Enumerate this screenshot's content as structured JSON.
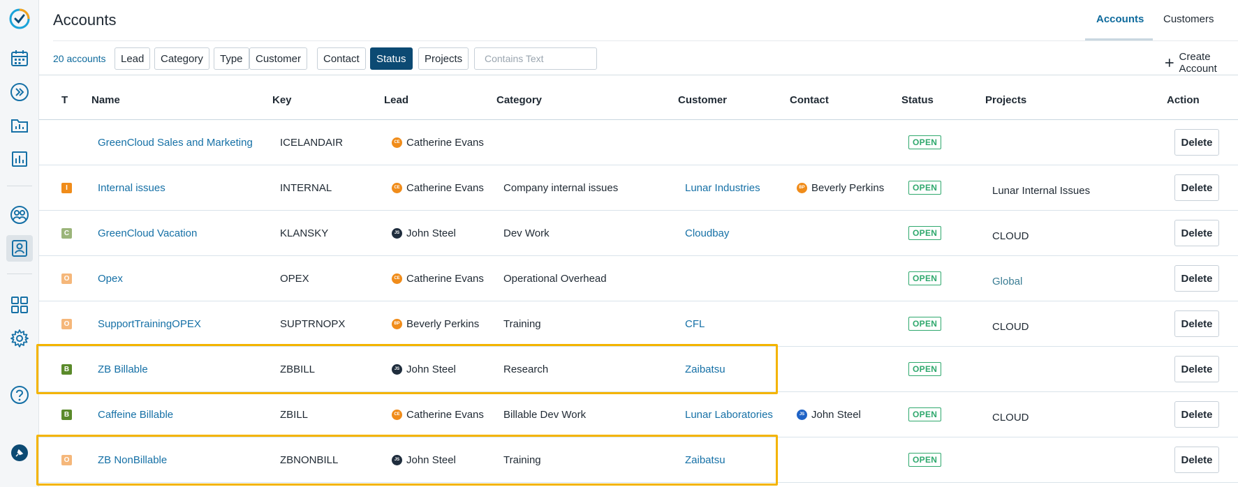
{
  "header": {
    "title": "Accounts",
    "tabs": [
      {
        "label": "Accounts",
        "active": true
      },
      {
        "label": "Customers",
        "active": false
      }
    ]
  },
  "filters": {
    "count_label": "20 accounts",
    "chips": [
      {
        "label": "Lead",
        "active": false
      },
      {
        "label": "Category",
        "active": false
      },
      {
        "label": "Type",
        "active": false
      },
      {
        "label": "Customer",
        "active": false
      },
      {
        "label": "Contact",
        "active": false
      },
      {
        "label": "Status",
        "active": true
      },
      {
        "label": "Projects",
        "active": false
      }
    ],
    "search_placeholder": "Contains Text",
    "create_label": "Create Account"
  },
  "table": {
    "columns": [
      "T",
      "Name",
      "Key",
      "Lead",
      "Category",
      "Customer",
      "Contact",
      "Status",
      "Projects",
      "Action"
    ],
    "rows": [
      {
        "type": "",
        "type_color": "",
        "name": "GreenCloud Sales and Marketing",
        "key": "ICELANDAIR",
        "lead": "Catherine Evans",
        "lead_initials": "CE",
        "lead_color": "#f08c1a",
        "category": "",
        "customer": "",
        "contact": "",
        "contact_initials": "",
        "contact_color": "",
        "status": "OPEN",
        "projects": "",
        "action": "Delete"
      },
      {
        "type": "I",
        "type_color": "#f08c1a",
        "name": "Internal issues",
        "key": "INTERNAL",
        "lead": "Catherine Evans",
        "lead_initials": "CE",
        "lead_color": "#f08c1a",
        "category": "Company internal issues",
        "customer": "Lunar Industries",
        "contact": "Beverly Perkins",
        "contact_initials": "BP",
        "contact_color": "#f08c1a",
        "status": "OPEN",
        "projects": "Lunar Internal Issues",
        "action": "Delete"
      },
      {
        "type": "C",
        "type_color": "#9bb57a",
        "name": "GreenCloud Vacation",
        "key": "KLANSKY",
        "lead": "John Steel",
        "lead_initials": "JS",
        "lead_color": "#1f2d3d",
        "category": "Dev Work",
        "customer": "Cloudbay",
        "contact": "",
        "contact_initials": "",
        "contact_color": "",
        "status": "OPEN",
        "projects": "CLOUD",
        "action": "Delete"
      },
      {
        "type": "O",
        "type_color": "#f5b77a",
        "name": "Opex",
        "key": "OPEX",
        "lead": "Catherine Evans",
        "lead_initials": "CE",
        "lead_color": "#f08c1a",
        "category": "Operational Overhead",
        "customer": "",
        "contact": "",
        "contact_initials": "",
        "contact_color": "",
        "status": "OPEN",
        "projects": "Global",
        "action": "Delete"
      },
      {
        "type": "O",
        "type_color": "#f5b77a",
        "name": "SupportTrainingOPEX",
        "key": "SUPTRNOPX",
        "lead": "Beverly Perkins",
        "lead_initials": "BP",
        "lead_color": "#f08c1a",
        "category": "Training",
        "customer": "CFL",
        "contact": "",
        "contact_initials": "",
        "contact_color": "",
        "status": "OPEN",
        "projects": "CLOUD",
        "action": "Delete"
      },
      {
        "type": "B",
        "type_color": "#5a8a2a",
        "name": "ZB Billable",
        "key": "ZBBILL",
        "lead": "John Steel",
        "lead_initials": "JS",
        "lead_color": "#1f2d3d",
        "category": "Research",
        "customer": "Zaibatsu",
        "contact": "",
        "contact_initials": "",
        "contact_color": "",
        "status": "OPEN",
        "projects": "",
        "action": "Delete"
      },
      {
        "type": "B",
        "type_color": "#5a8a2a",
        "name": "Caffeine Billable",
        "key": "ZBILL",
        "lead": "Catherine Evans",
        "lead_initials": "CE",
        "lead_color": "#f08c1a",
        "category": "Billable Dev Work",
        "customer": "Lunar Laboratories",
        "contact": "John Steel",
        "contact_initials": "JS",
        "contact_color": "#1f63c6",
        "status": "OPEN",
        "projects": "CLOUD",
        "action": "Delete"
      },
      {
        "type": "O",
        "type_color": "#f5b77a",
        "name": "ZB NonBillable",
        "key": "ZBNONBILL",
        "lead": "John Steel",
        "lead_initials": "JS",
        "lead_color": "#1f2d3d",
        "category": "Training",
        "customer": "Zaibatsu",
        "contact": "",
        "contact_initials": "",
        "contact_color": "",
        "status": "OPEN",
        "projects": "",
        "action": "Delete"
      }
    ]
  },
  "sidebar": {
    "icons": [
      "logo-check-icon",
      "calendar-icon",
      "chevron-double-right-icon",
      "folder-chart-icon",
      "bar-chart-icon",
      "team-icon",
      "account-card-icon",
      "apps-grid-icon",
      "gear-icon",
      "help-icon",
      "pin-icon"
    ]
  }
}
